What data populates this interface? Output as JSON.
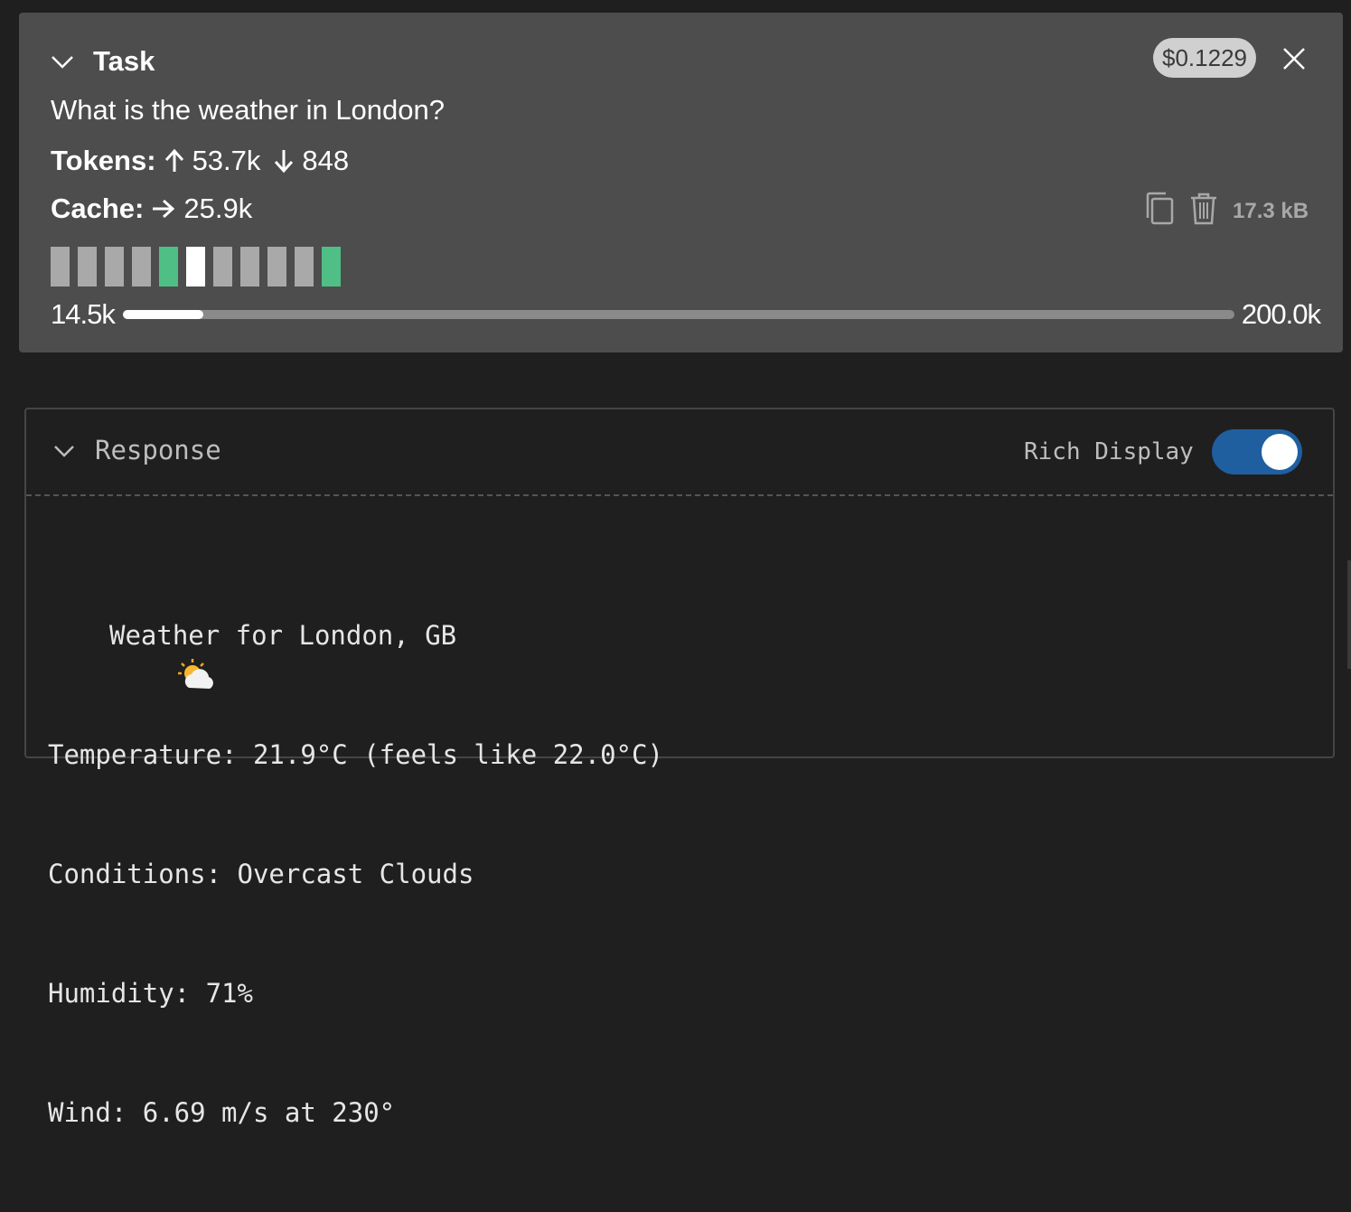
{
  "task": {
    "title": "Task",
    "cost": "$0.1229",
    "text": "What is the weather in London?",
    "tokens_label": "Tokens:",
    "tokens_in": "53.7k",
    "tokens_out": "848",
    "cache_label": "Cache:",
    "cache_value": "25.9k",
    "size": "17.3 kB",
    "blocks": [
      "gray",
      "gray",
      "gray",
      "gray",
      "green",
      "white",
      "gray",
      "gray",
      "gray",
      "gray",
      "green"
    ],
    "context": {
      "used": "14.5k",
      "max": "200.0k",
      "fraction": 0.0725
    },
    "colors": {
      "gray": "#a9a9a9",
      "green": "#4fbf85",
      "white": "#ffffff"
    },
    "icons": [
      "chevron-down-icon",
      "close-icon",
      "arrow-up-icon",
      "arrow-down-icon",
      "arrow-right-icon",
      "copy-icon",
      "trash-icon"
    ]
  },
  "response": {
    "title": "Response",
    "rich_display_label": "Rich Display",
    "rich_display_on": true,
    "toggle_color": "#1f5fa0",
    "lines": {
      "header": "Weather for London, GB",
      "temperature": "Temperature: 21.9°C (feels like 22.0°C)",
      "conditions": "Conditions: Overcast Clouds",
      "humidity": "Humidity: 71%",
      "wind": "Wind: 6.69 m/s at 230°"
    },
    "weather_icon": "sun-behind-cloud-icon"
  }
}
